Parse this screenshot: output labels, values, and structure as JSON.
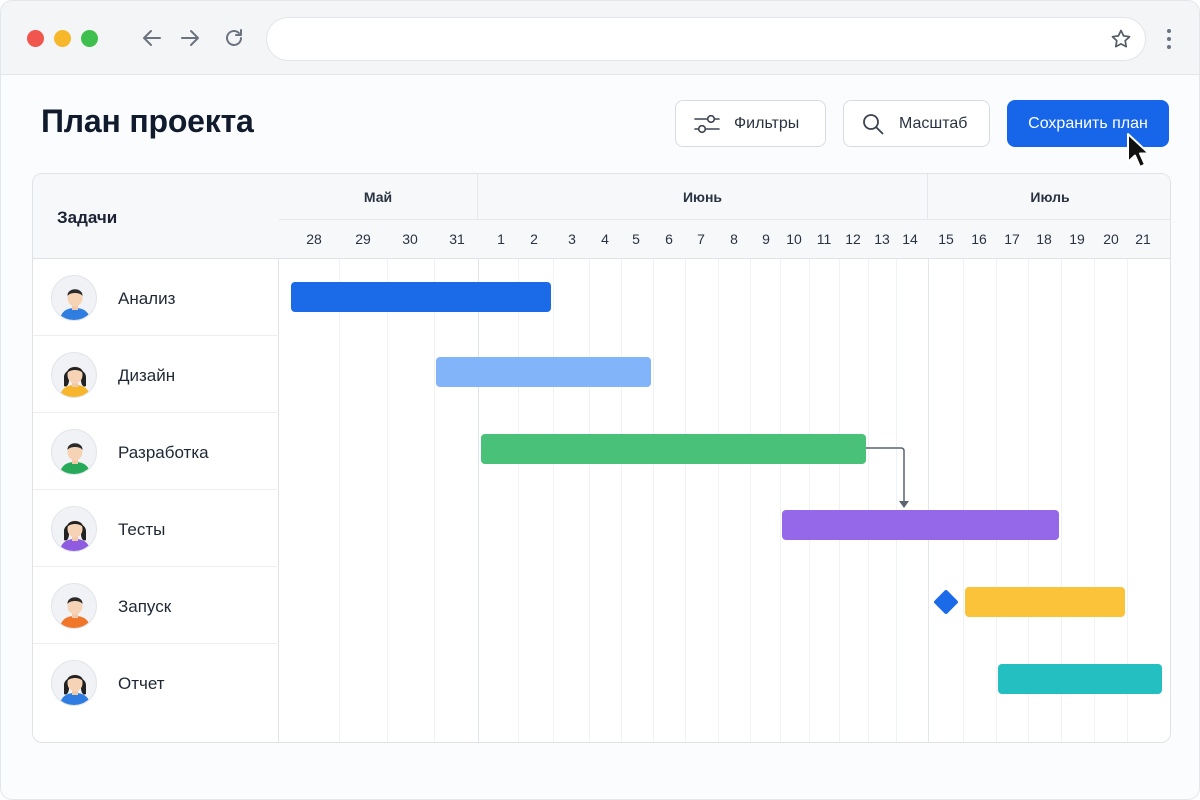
{
  "browser": {
    "url": ""
  },
  "header": {
    "title": "План проекта",
    "filter_label": "Фильтры",
    "zoom_label": "Масштаб",
    "save_label": "Сохранить план"
  },
  "gantt": {
    "tasks_header": "Задачи",
    "months": [
      {
        "label": "Май"
      },
      {
        "label": "Июнь"
      },
      {
        "label": "Июль"
      }
    ],
    "days": [
      "28",
      "29",
      "30",
      "31",
      "1",
      "2",
      "3",
      "4",
      "5",
      "6",
      "7",
      "8",
      "9",
      "10",
      "11",
      "12",
      "13",
      "14",
      "15",
      "16",
      "17",
      "18",
      "19",
      "20",
      "21"
    ],
    "tasks": [
      {
        "name": "Анализ",
        "avatar": "male-avatar",
        "shirt": "#2f7de1",
        "hair": "#2b2b2b",
        "hair_style": "short"
      },
      {
        "name": "Дизайн",
        "avatar": "female-avatar",
        "shirt": "#f6b52a",
        "hair": "#222222",
        "hair_style": "long"
      },
      {
        "name": "Разработка",
        "avatar": "male-avatar",
        "shirt": "#27a95a",
        "hair": "#2b2b2b",
        "hair_style": "short"
      },
      {
        "name": "Тесты",
        "avatar": "female-avatar",
        "shirt": "#8f5be0",
        "hair": "#222222",
        "hair_style": "long"
      },
      {
        "name": "Запуск",
        "avatar": "male-avatar",
        "shirt": "#f0772a",
        "hair": "#2b2b2b",
        "hair_style": "short"
      },
      {
        "name": "Отчет",
        "avatar": "female-avatar",
        "shirt": "#2f7de1",
        "hair": "#222222",
        "hair_style": "long"
      }
    ],
    "bars": [
      {
        "task": "Анализ",
        "start": "28 мая",
        "end": "2 июня",
        "color": "#1b6ae8"
      },
      {
        "task": "Дизайн",
        "start": "31 мая",
        "end": "5 июня",
        "color": "#82b4fa"
      },
      {
        "task": "Разработка",
        "start": "1 июня",
        "end": "12 июня",
        "color": "#4ac178"
      },
      {
        "task": "Тесты",
        "start": "10 июня",
        "end": "18 июня",
        "color": "#9468e8"
      },
      {
        "task": "Запуск",
        "start": "16 июня",
        "end": "20 июня",
        "color": "#fbc33a"
      },
      {
        "task": "Отчет",
        "start": "17 июня",
        "end": "21 июня",
        "color": "#23bfc1"
      }
    ],
    "milestone": {
      "task": "Запуск",
      "date": "15 июня",
      "color": "#1b6ae8"
    },
    "dependency": {
      "from": "Разработка",
      "to": "Тесты",
      "color": "#5b6472"
    }
  }
}
